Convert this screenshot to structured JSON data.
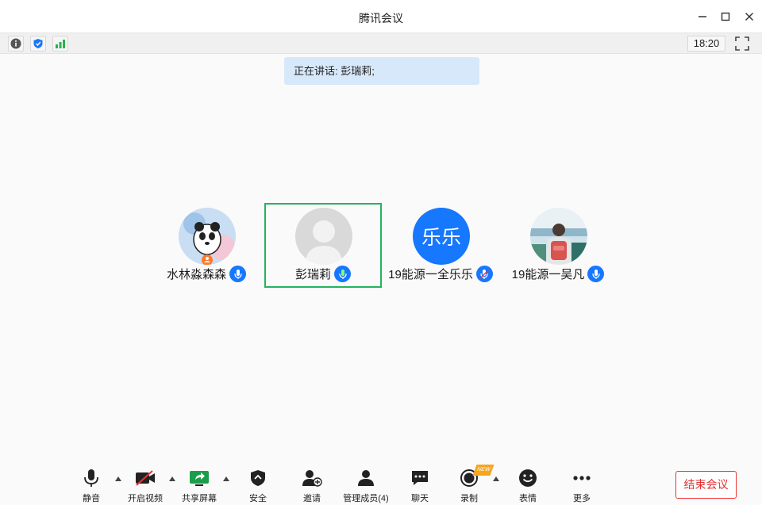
{
  "window": {
    "title": "腾讯会议",
    "minimize_icon": "minimize-icon",
    "maximize_icon": "maximize-icon",
    "close_icon": "close-icon"
  },
  "toolbar": {
    "info_icon": "info-icon",
    "security_icon": "shield-icon",
    "signal_icon": "signal-bars-icon",
    "time": "18:20",
    "fullscreen_icon": "fullscreen-icon"
  },
  "speaking_banner": "正在讲话: 彭瑞莉;",
  "participants": [
    {
      "name": "水林淼森森",
      "avatar": "panda-avatar",
      "mic": "mic-icon",
      "host": true,
      "active": false
    },
    {
      "name": "彭瑞莉",
      "avatar": "default-person-avatar",
      "mic": "mic-icon",
      "host": false,
      "active": true
    },
    {
      "name": "19能源一全乐乐",
      "avatar_text": "乐乐",
      "mic": "mic-muted-icon",
      "host": false,
      "active": false
    },
    {
      "name": "19能源一吴凡",
      "avatar": "photo-avatar",
      "mic": "mic-icon",
      "host": false,
      "active": false
    }
  ],
  "bottom_bar": {
    "mute": "静音",
    "video": "开启视频",
    "share": "共享屏幕",
    "security": "安全",
    "invite": "邀请",
    "members": "管理成员(4)",
    "chat": "聊天",
    "record": "录制",
    "record_badge": "NEW",
    "emoji": "表情",
    "more": "更多",
    "end": "结束会议"
  },
  "colors": {
    "accent_blue": "#1677ff",
    "active_border": "#24b35e",
    "speaking_bg": "#d7e8fb",
    "end_red": "#e03030"
  }
}
